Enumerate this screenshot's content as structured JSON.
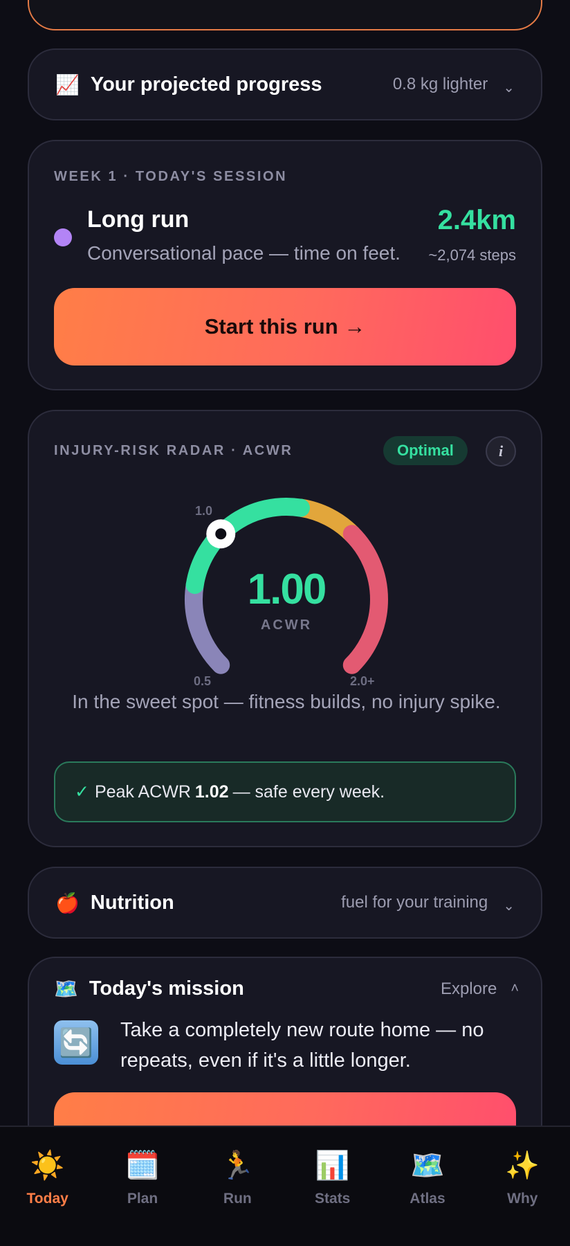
{
  "progress": {
    "emoji": "📈",
    "title": "Your projected progress",
    "summary": "0.8 kg lighter",
    "chevron": "⌄"
  },
  "session": {
    "eyebrow": "WEEK 1 · TODAY'S SESSION",
    "dot_color": "#b384f6",
    "title": "Long run",
    "description": "Conversational pace — time on feet.",
    "distance": "2.4km",
    "steps": "~2,074 steps",
    "start_label": "Start this run →"
  },
  "radar": {
    "eyebrow": "INJURY-RISK RADAR · ACWR",
    "status_badge": "Optimal",
    "info_label": "i",
    "value": "1.00",
    "value_numeric": 1.0,
    "unit": "ACWR",
    "tick_min": "0.5",
    "tick_optimal": "1.0",
    "tick_max": "2.0+",
    "caption": "In the sweet spot — fitness builds, no injury spike.",
    "peak": {
      "check": "✓",
      "prefix": "Peak ACWR",
      "value": "1.02",
      "suffix": "— safe every week."
    },
    "colors": {
      "low": "#8a85b8",
      "optimal": "#35e0a0",
      "caution": "#e2a63b",
      "danger": "#e35a72"
    }
  },
  "nutrition": {
    "emoji": "🍎",
    "title": "Nutrition",
    "summary": "fuel for your training",
    "chevron": "⌄"
  },
  "mission": {
    "emoji": "🗺️",
    "title": "Today's mission",
    "summary": "Explore",
    "chevron": "˄",
    "icon": "🔄",
    "text": "Take a completely new route home — no repeats, even if it's a little longer."
  },
  "tabs": [
    {
      "icon": "☀️",
      "label": "Today",
      "active": true
    },
    {
      "icon": "🗓️",
      "label": "Plan",
      "active": false
    },
    {
      "icon": "🏃",
      "label": "Run",
      "active": false
    },
    {
      "icon": "📊",
      "label": "Stats",
      "active": false
    },
    {
      "icon": "🗺️",
      "label": "Atlas",
      "active": false
    },
    {
      "icon": "✨",
      "label": "Why",
      "active": false
    }
  ],
  "accent_color": "#ff7e47"
}
